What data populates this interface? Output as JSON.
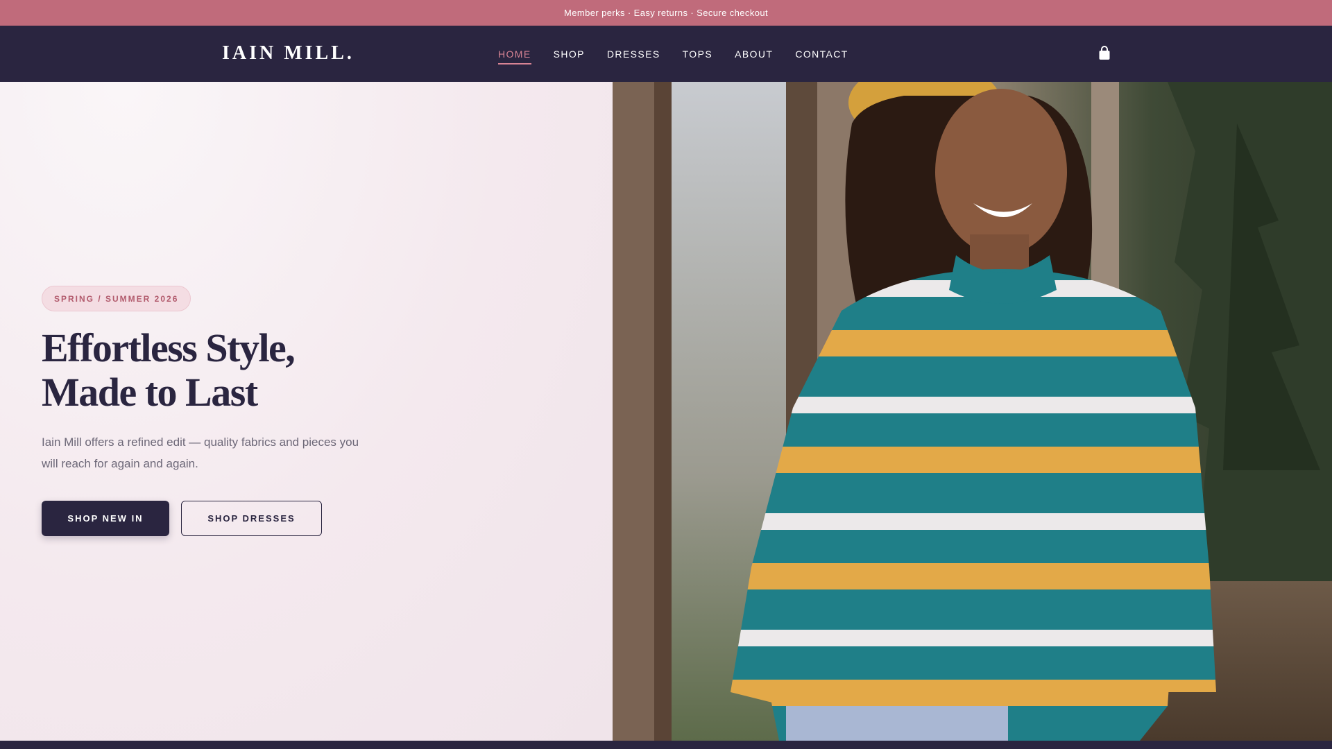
{
  "announcement": "Member perks · Easy returns · Secure checkout",
  "brand": {
    "logo": "IAIN MILL."
  },
  "nav": {
    "items": [
      {
        "label": "HOME",
        "active": true
      },
      {
        "label": "SHOP",
        "active": false
      },
      {
        "label": "DRESSES",
        "active": false
      },
      {
        "label": "TOPS",
        "active": false
      },
      {
        "label": "ABOUT",
        "active": false
      },
      {
        "label": "CONTACT",
        "active": false
      }
    ],
    "cart_icon": "shopping-bag-icon"
  },
  "hero": {
    "badge": "SPRING / SUMMER 2026",
    "title_line1": "Effortless Style,",
    "title_line2": "Made to Last",
    "description": "Iain Mill offers a refined edit — quality fabrics and pieces you will reach for again and again.",
    "primary_button": "SHOP NEW IN",
    "secondary_button": "SHOP DRESSES",
    "image_subject": "hero-photo"
  },
  "colors": {
    "accent": "#c06b7b",
    "nav_active": "#d88494",
    "dark": "#2a2540",
    "hero_bg": "#f4e9ee"
  }
}
